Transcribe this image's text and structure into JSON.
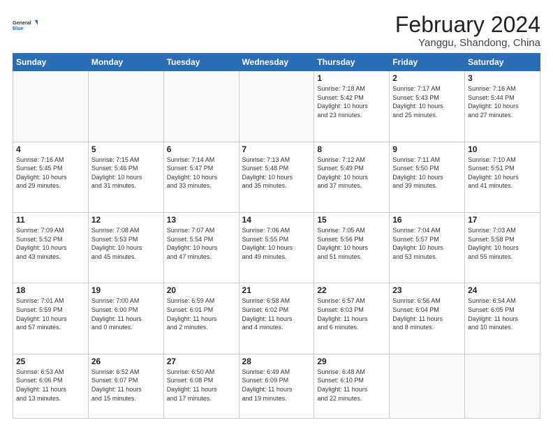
{
  "logo": {
    "line1": "General",
    "line2": "Blue"
  },
  "title": "February 2024",
  "subtitle": "Yanggu, Shandong, China",
  "weekdays": [
    "Sunday",
    "Monday",
    "Tuesday",
    "Wednesday",
    "Thursday",
    "Friday",
    "Saturday"
  ],
  "weeks": [
    [
      {
        "day": "",
        "info": ""
      },
      {
        "day": "",
        "info": ""
      },
      {
        "day": "",
        "info": ""
      },
      {
        "day": "",
        "info": ""
      },
      {
        "day": "1",
        "info": "Sunrise: 7:18 AM\nSunset: 5:42 PM\nDaylight: 10 hours\nand 23 minutes."
      },
      {
        "day": "2",
        "info": "Sunrise: 7:17 AM\nSunset: 5:43 PM\nDaylight: 10 hours\nand 25 minutes."
      },
      {
        "day": "3",
        "info": "Sunrise: 7:16 AM\nSunset: 5:44 PM\nDaylight: 10 hours\nand 27 minutes."
      }
    ],
    [
      {
        "day": "4",
        "info": "Sunrise: 7:16 AM\nSunset: 5:45 PM\nDaylight: 10 hours\nand 29 minutes."
      },
      {
        "day": "5",
        "info": "Sunrise: 7:15 AM\nSunset: 5:46 PM\nDaylight: 10 hours\nand 31 minutes."
      },
      {
        "day": "6",
        "info": "Sunrise: 7:14 AM\nSunset: 5:47 PM\nDaylight: 10 hours\nand 33 minutes."
      },
      {
        "day": "7",
        "info": "Sunrise: 7:13 AM\nSunset: 5:48 PM\nDaylight: 10 hours\nand 35 minutes."
      },
      {
        "day": "8",
        "info": "Sunrise: 7:12 AM\nSunset: 5:49 PM\nDaylight: 10 hours\nand 37 minutes."
      },
      {
        "day": "9",
        "info": "Sunrise: 7:11 AM\nSunset: 5:50 PM\nDaylight: 10 hours\nand 39 minutes."
      },
      {
        "day": "10",
        "info": "Sunrise: 7:10 AM\nSunset: 5:51 PM\nDaylight: 10 hours\nand 41 minutes."
      }
    ],
    [
      {
        "day": "11",
        "info": "Sunrise: 7:09 AM\nSunset: 5:52 PM\nDaylight: 10 hours\nand 43 minutes."
      },
      {
        "day": "12",
        "info": "Sunrise: 7:08 AM\nSunset: 5:53 PM\nDaylight: 10 hours\nand 45 minutes."
      },
      {
        "day": "13",
        "info": "Sunrise: 7:07 AM\nSunset: 5:54 PM\nDaylight: 10 hours\nand 47 minutes."
      },
      {
        "day": "14",
        "info": "Sunrise: 7:06 AM\nSunset: 5:55 PM\nDaylight: 10 hours\nand 49 minutes."
      },
      {
        "day": "15",
        "info": "Sunrise: 7:05 AM\nSunset: 5:56 PM\nDaylight: 10 hours\nand 51 minutes."
      },
      {
        "day": "16",
        "info": "Sunrise: 7:04 AM\nSunset: 5:57 PM\nDaylight: 10 hours\nand 53 minutes."
      },
      {
        "day": "17",
        "info": "Sunrise: 7:03 AM\nSunset: 5:58 PM\nDaylight: 10 hours\nand 55 minutes."
      }
    ],
    [
      {
        "day": "18",
        "info": "Sunrise: 7:01 AM\nSunset: 5:59 PM\nDaylight: 10 hours\nand 57 minutes."
      },
      {
        "day": "19",
        "info": "Sunrise: 7:00 AM\nSunset: 6:00 PM\nDaylight: 11 hours\nand 0 minutes."
      },
      {
        "day": "20",
        "info": "Sunrise: 6:59 AM\nSunset: 6:01 PM\nDaylight: 11 hours\nand 2 minutes."
      },
      {
        "day": "21",
        "info": "Sunrise: 6:58 AM\nSunset: 6:02 PM\nDaylight: 11 hours\nand 4 minutes."
      },
      {
        "day": "22",
        "info": "Sunrise: 6:57 AM\nSunset: 6:03 PM\nDaylight: 11 hours\nand 6 minutes."
      },
      {
        "day": "23",
        "info": "Sunrise: 6:56 AM\nSunset: 6:04 PM\nDaylight: 11 hours\nand 8 minutes."
      },
      {
        "day": "24",
        "info": "Sunrise: 6:54 AM\nSunset: 6:05 PM\nDaylight: 11 hours\nand 10 minutes."
      }
    ],
    [
      {
        "day": "25",
        "info": "Sunrise: 6:53 AM\nSunset: 6:06 PM\nDaylight: 11 hours\nand 13 minutes."
      },
      {
        "day": "26",
        "info": "Sunrise: 6:52 AM\nSunset: 6:07 PM\nDaylight: 11 hours\nand 15 minutes."
      },
      {
        "day": "27",
        "info": "Sunrise: 6:50 AM\nSunset: 6:08 PM\nDaylight: 11 hours\nand 17 minutes."
      },
      {
        "day": "28",
        "info": "Sunrise: 6:49 AM\nSunset: 6:09 PM\nDaylight: 11 hours\nand 19 minutes."
      },
      {
        "day": "29",
        "info": "Sunrise: 6:48 AM\nSunset: 6:10 PM\nDaylight: 11 hours\nand 22 minutes."
      },
      {
        "day": "",
        "info": ""
      },
      {
        "day": "",
        "info": ""
      }
    ]
  ]
}
